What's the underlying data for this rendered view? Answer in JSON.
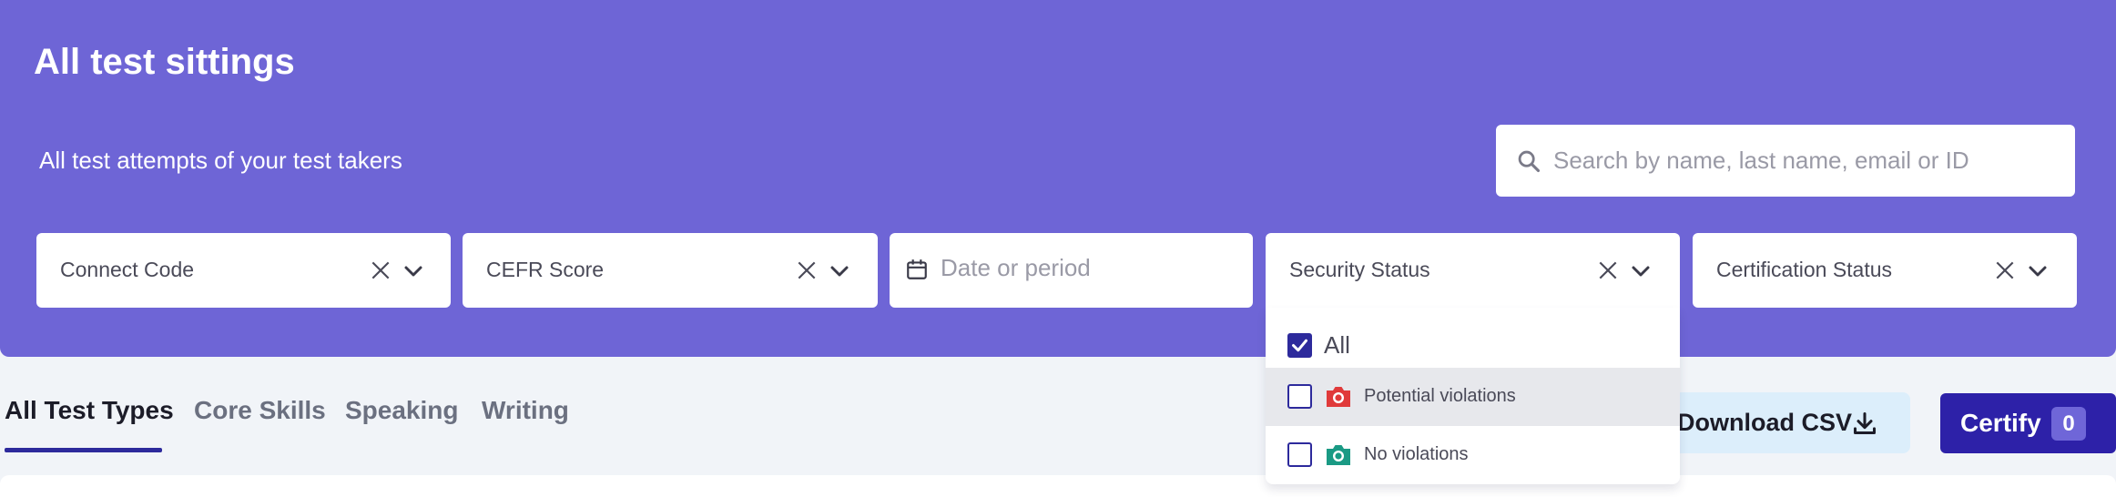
{
  "header": {
    "title": "All test sittings",
    "subtitle": "All test attempts of your test takers"
  },
  "search": {
    "placeholder": "Search by name, last name, email or ID",
    "value": "",
    "icon": "search-icon"
  },
  "filters": {
    "connect_code": "Connect Code",
    "cefr_score": "CEFR Score",
    "date_placeholder": "Date or period",
    "security_status": "Security Status",
    "certification_status": "Certification Status"
  },
  "security_dropdown": {
    "options": [
      {
        "label": "All",
        "checked": true
      },
      {
        "label": "Potential violations",
        "checked": false,
        "icon": "camera-icon",
        "icon_color": "#e03a3a"
      },
      {
        "label": "No violations",
        "checked": false,
        "icon": "camera-icon",
        "icon_color": "#1a9a84"
      }
    ]
  },
  "tabs": [
    "All Test Types",
    "Core Skills",
    "Speaking",
    "Writing"
  ],
  "active_tab": "All Test Types",
  "actions": {
    "download_csv": "Download CSV",
    "certify": "Certify",
    "certify_count": "0"
  },
  "colors": {
    "banner": "#6e65d6",
    "accent": "#2d2a9c",
    "certify_button": "#2d21a8",
    "csv_button": "#dceefb",
    "violation": "#e03a3a",
    "ok": "#1a9a84"
  }
}
